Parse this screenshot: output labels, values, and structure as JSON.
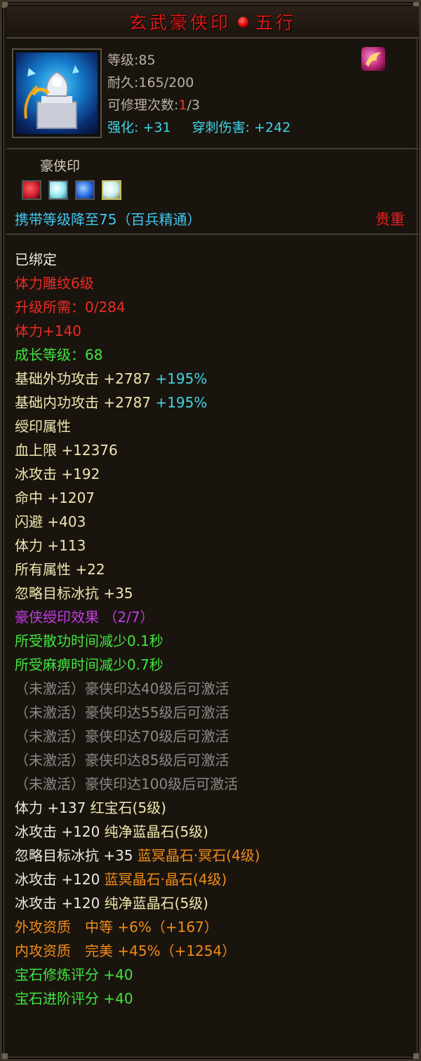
{
  "title": {
    "part1": "玄武豪侠印",
    "part2": "五行"
  },
  "item": {
    "level_label": "等级:",
    "level": "85",
    "durability_label": "耐久:",
    "durability": "165/200",
    "repair_label": "可修理次数:",
    "repair_current": "1",
    "repair_total": "/3",
    "enhance_label": "强化:",
    "enhance_value": "+31",
    "pierce_label": "穿刺伤害:",
    "pierce_value": "+242"
  },
  "subname": "豪侠印",
  "gems": [
    {
      "name": "red-gem",
      "color": "#c8192a"
    },
    {
      "name": "cyan-gem",
      "color": "#8fe8f0"
    },
    {
      "name": "blue-gem",
      "color": "#2a6ee8"
    },
    {
      "name": "white-gem",
      "color": "#f0f0d0"
    }
  ],
  "carry_text": "携带等级降至75（百兵精通）",
  "precious_label": "贵重",
  "attributes": [
    {
      "text": "已绑定",
      "color": "white"
    },
    {
      "text": "体力雕纹6级",
      "color": "red"
    },
    {
      "text": "升级所需：0/284",
      "color": "red"
    },
    {
      "text": "体力+140",
      "color": "red"
    },
    {
      "text": "成长等级：68",
      "color": "green"
    },
    {
      "text": "基础外功攻击 +2787",
      "extra": " +195%",
      "color": "yellow"
    },
    {
      "text": "基础内功攻击 +2787",
      "extra": " +195%",
      "color": "yellow"
    },
    {
      "text": "绶印属性",
      "color": "yellow"
    },
    {
      "text": "血上限 +12376",
      "color": "yellow"
    },
    {
      "text": "冰攻击 +192",
      "color": "yellow"
    },
    {
      "text": "命中 +1207",
      "color": "yellow"
    },
    {
      "text": "闪避 +403",
      "color": "yellow"
    },
    {
      "text": "体力 +113",
      "color": "yellow"
    },
    {
      "text": "所有属性 +22",
      "color": "yellow"
    },
    {
      "text": "忽略目标冰抗 +35",
      "color": "yellow"
    },
    {
      "text": "豪侠绶印效果 （2/7）",
      "color": "purple"
    },
    {
      "text": "所受散功时间减少0.1秒",
      "color": "green"
    },
    {
      "text": "所受麻痹时间减少0.7秒",
      "color": "green"
    },
    {
      "text": "（未激活）豪侠印达40级后可激活",
      "color": "gray"
    },
    {
      "text": "（未激活）豪侠印达55级后可激活",
      "color": "gray"
    },
    {
      "text": "（未激活）豪侠印达70级后可激活",
      "color": "gray"
    },
    {
      "text": "（未激活）豪侠印达85级后可激活",
      "color": "gray"
    },
    {
      "text": "（未激活）豪侠印达100级后可激活",
      "color": "gray"
    },
    {
      "text": "体力 +137 ",
      "extra": "红宝石(5级)",
      "color": "white",
      "extra_color": "yellow"
    },
    {
      "text": "冰攻击 +120 ",
      "extra": "纯净蓝晶石(5级)",
      "color": "white",
      "extra_color": "yellow"
    },
    {
      "text": "忽略目标冰抗 +35 ",
      "extra": "蓝冥晶石·冥石(4级)",
      "color": "white",
      "extra_color": "orange"
    },
    {
      "text": "冰攻击 +120 ",
      "extra": "蓝冥晶石·晶石(4级)",
      "color": "white",
      "extra_color": "orange"
    },
    {
      "text": "冰攻击 +120 ",
      "extra": "纯净蓝晶石(5级)",
      "color": "white",
      "extra_color": "yellow"
    },
    {
      "text": "外攻资质　中等 +6%（+167）",
      "color": "orange"
    },
    {
      "text": "内攻资质　完美 +45%（+1254）",
      "color": "orange"
    },
    {
      "text": "宝石修炼评分 +40",
      "color": "green"
    },
    {
      "text": "宝石进阶评分 +40",
      "color": "green"
    }
  ]
}
